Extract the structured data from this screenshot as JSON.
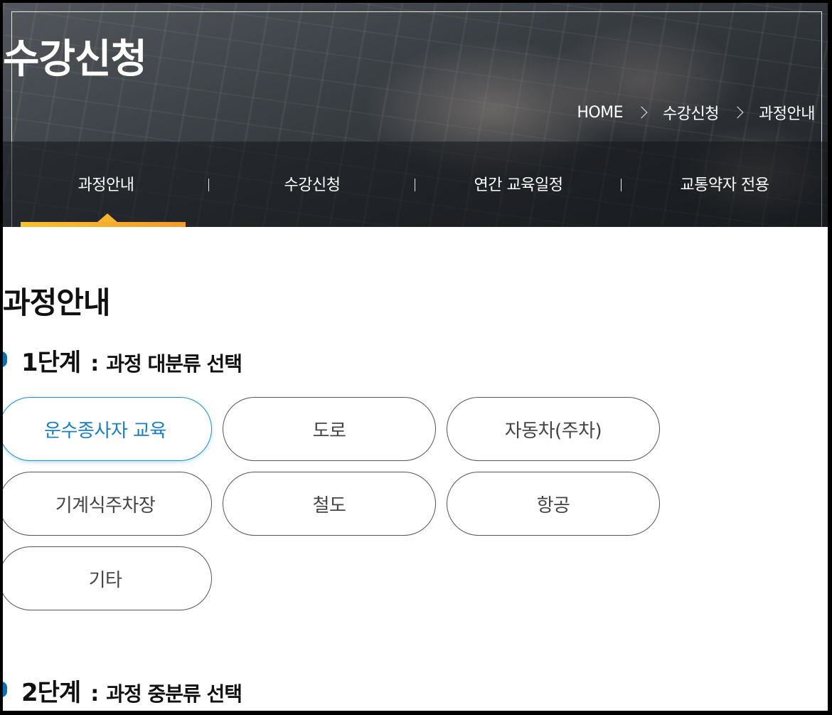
{
  "header": {
    "title": "수강신청",
    "breadcrumb": [
      "HOME",
      "수강신청",
      "과정안내"
    ]
  },
  "subnav": {
    "items": [
      {
        "label": "과정안내",
        "active": true
      },
      {
        "label": "수강신청",
        "active": false
      },
      {
        "label": "연간 교육일정",
        "active": false
      },
      {
        "label": "교통약자 전용",
        "active": false
      }
    ],
    "active_color": "#f7b52f"
  },
  "main": {
    "page_title": "과정안내",
    "step1": {
      "number": "1단계",
      "colon": ":",
      "label": "과정 대분류 선택"
    },
    "step2": {
      "number": "2단계",
      "colon": ":",
      "label": "과정 중분류 선택"
    },
    "categories": [
      {
        "label": "운수종사자 교육",
        "selected": true
      },
      {
        "label": "도로",
        "selected": false
      },
      {
        "label": "자동차(주차)",
        "selected": false
      },
      {
        "label": "기계식주차장",
        "selected": false
      },
      {
        "label": "철도",
        "selected": false
      },
      {
        "label": "항공",
        "selected": false
      },
      {
        "label": "기타",
        "selected": false
      }
    ],
    "accent_color": "#1a8fcf",
    "step_marker_color": "#0b6fb0"
  }
}
